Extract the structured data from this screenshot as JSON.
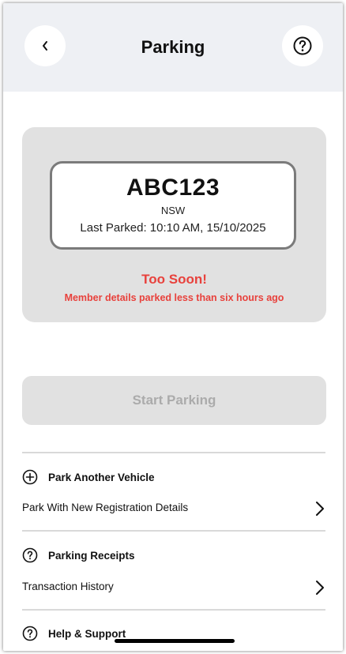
{
  "header": {
    "title": "Parking"
  },
  "vehicle": {
    "plate": "ABC123",
    "state": "NSW",
    "last_parked": "Last Parked: 10:10 AM, 15/10/2025",
    "warning_title": "Too Soon!",
    "warning_message": "Member details parked less than six hours ago"
  },
  "actions": {
    "start_parking": "Start Parking"
  },
  "sections": [
    {
      "title": "Park Another Vehicle",
      "icon": "plus-circle-icon",
      "item": "Park With New Registration Details"
    },
    {
      "title": "Parking Receipts",
      "icon": "question-circle-icon",
      "item": "Transaction History"
    },
    {
      "title": "Help & Support",
      "icon": "question-circle-icon"
    }
  ],
  "colors": {
    "header_bg": "#eef0f4",
    "card_bg": "#e1e1e1",
    "warning": "#e8413c",
    "disabled_text": "#ababab"
  }
}
